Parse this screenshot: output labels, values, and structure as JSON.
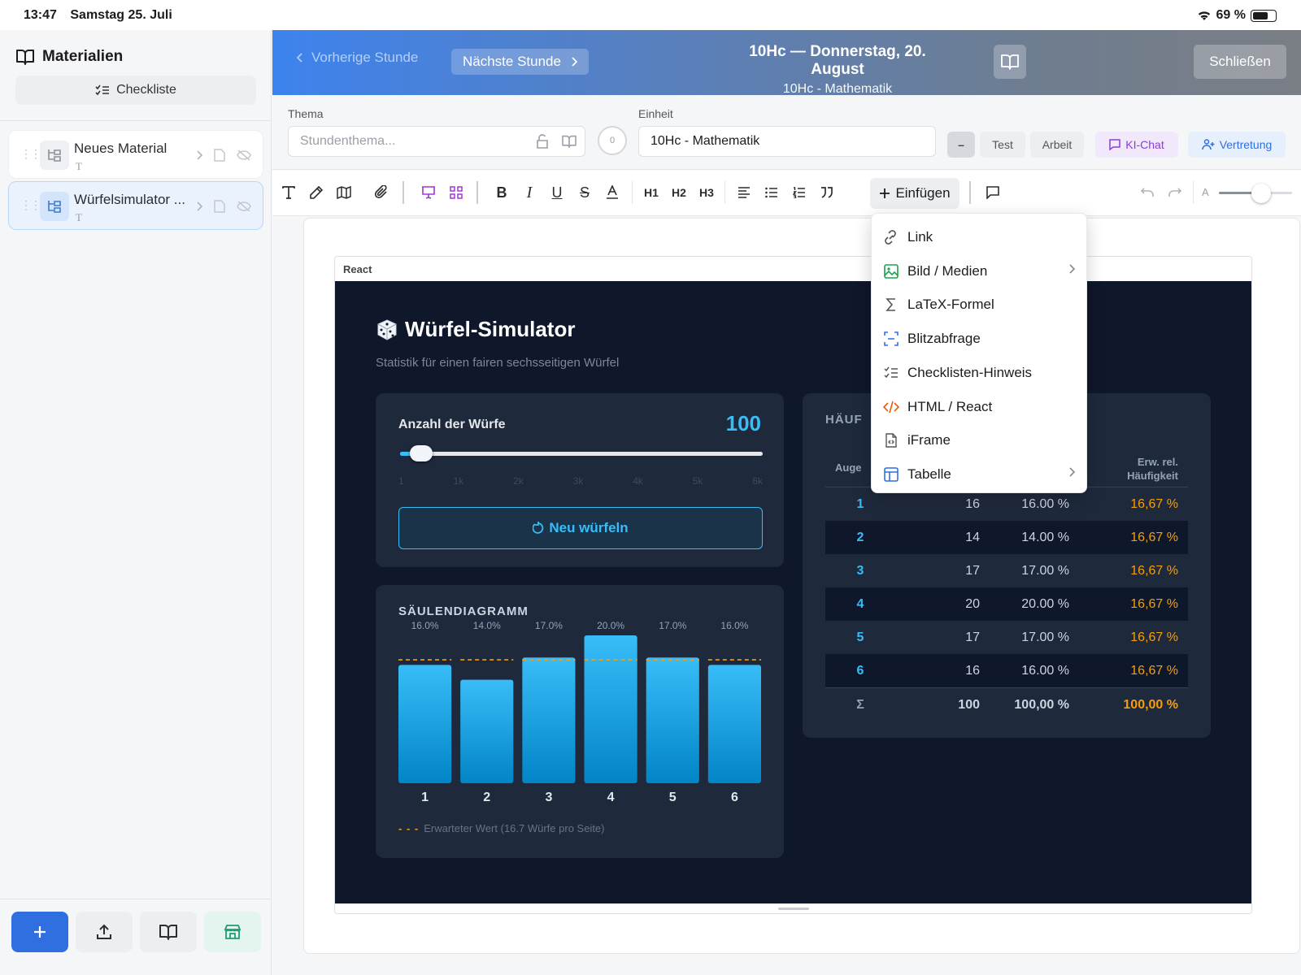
{
  "status_bar": {
    "time": "13:47",
    "date": "Samstag 25. Juli",
    "battery": "69 %",
    "battery_level": 0.69
  },
  "sidebar": {
    "heading": "Materialien",
    "checklist_label": "Checkliste",
    "items": [
      {
        "title": "Neues Material",
        "subtitle": "T"
      },
      {
        "title": "Würfelsimulator ...",
        "subtitle": "T"
      }
    ]
  },
  "header": {
    "prev_label": "Vorherige Stunde",
    "next_label": "Nächste Stunde",
    "title": "10Hc — Donnerstag, 20. August",
    "subtitle": "10Hc - Mathematik",
    "close_label": "Schließen"
  },
  "meta": {
    "topic_label": "Thema",
    "topic_placeholder": "Stundenthema...",
    "counter": "0",
    "unit_label": "Einheit",
    "unit_value": "10Hc - Mathematik",
    "type_dash": "–",
    "type_test": "Test",
    "type_arbeit": "Arbeit",
    "ki_chat": "KI-Chat",
    "vertretung": "Vertretung"
  },
  "toolbar": {
    "h1": "H1",
    "h2": "H2",
    "h3": "H3",
    "insert_label": "Einfügen",
    "zoom_label": "A",
    "zoom_level": 0.58
  },
  "insert_menu": {
    "items": [
      {
        "label": "Link",
        "icon": "link-icon",
        "submenu": false
      },
      {
        "label": "Bild / Medien",
        "icon": "image-icon",
        "submenu": true
      },
      {
        "label": "LaTeX-Formel",
        "icon": "sigma-icon",
        "submenu": false
      },
      {
        "label": "Blitzabfrage",
        "icon": "scan-icon",
        "submenu": false
      },
      {
        "label": "Checklisten-Hinweis",
        "icon": "checklist-icon",
        "submenu": false
      },
      {
        "label": "HTML / React",
        "icon": "code-icon",
        "submenu": false
      },
      {
        "label": "iFrame",
        "icon": "file-code-icon",
        "submenu": false
      },
      {
        "label": "Tabelle",
        "icon": "table-icon",
        "submenu": true
      }
    ]
  },
  "react_block": {
    "label": "React",
    "app_title": "Würfel-Simulator",
    "app_subtitle": "Statistik für einen fairen sechsseitigen Würfel",
    "throws_label": "Anzahl der Würfe",
    "throws_value": "100",
    "slider_min": 1,
    "slider_max": 6000,
    "slider_value": 100,
    "slider_ticks": [
      "1",
      "1k",
      "2k",
      "3k",
      "4k",
      "5k",
      "6k"
    ],
    "roll_label": "Neu würfeln",
    "chart_title": "SÄULENDIAGRAMM",
    "legend_dash": "- - -",
    "legend_label": "Erwarteter Wert (16.7 Würfe pro Seite)",
    "table_title": "HÄUF",
    "table_header_face": "Auge",
    "table_header_exp_1": "Erw. rel.",
    "table_header_exp_2": "Häufigkeit",
    "table_rows": [
      {
        "face": "1",
        "count": "16",
        "rel": "16.00 %",
        "exp": "16,67 %"
      },
      {
        "face": "2",
        "count": "14",
        "rel": "14.00 %",
        "exp": "16,67 %"
      },
      {
        "face": "3",
        "count": "17",
        "rel": "17.00 %",
        "exp": "16,67 %"
      },
      {
        "face": "4",
        "count": "20",
        "rel": "20.00 %",
        "exp": "16,67 %"
      },
      {
        "face": "5",
        "count": "17",
        "rel": "17.00 %",
        "exp": "16,67 %"
      },
      {
        "face": "6",
        "count": "16",
        "rel": "16.00 %",
        "exp": "16,67 %"
      }
    ],
    "table_sum": {
      "face": "Σ",
      "count": "100",
      "rel": "100,00 %",
      "exp": "100,00 %"
    }
  },
  "chart_data": {
    "type": "bar",
    "categories": [
      "1",
      "2",
      "3",
      "4",
      "5",
      "6"
    ],
    "values": [
      16,
      14,
      17,
      20,
      17,
      16
    ],
    "value_labels": [
      "16.0%",
      "14.0%",
      "17.0%",
      "20.0%",
      "17.0%",
      "16.0%"
    ],
    "expected": 16.7,
    "title": "SÄULENDIAGRAMM",
    "ylim": [
      0,
      20
    ]
  },
  "colors": {
    "accent": "#2f6fe0",
    "bar": "#0ea5e9",
    "expected": "#f59e0b",
    "app_bg": "#0f172a",
    "card": "#1e293b"
  }
}
